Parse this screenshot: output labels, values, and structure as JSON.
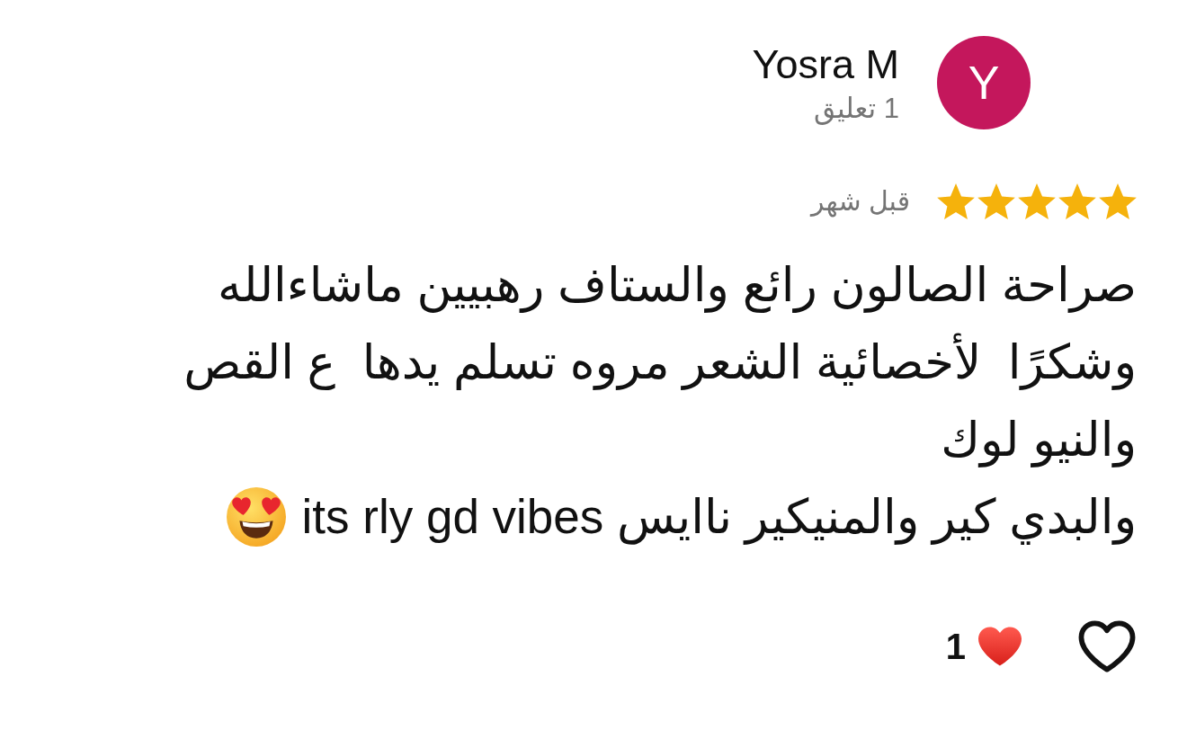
{
  "reviewer": {
    "initial": "Y",
    "name": "Yosra M",
    "comment_count": "1 تعليق"
  },
  "rating": {
    "stars": 5,
    "time": "قبل شهر"
  },
  "review": {
    "paragraphs": [
      "صراحة الصالون رائع والستاف رهبيين ماشاءالله\nوشكرًا  لأخصائية الشعر مروه تسلم يدها  ع القص\nوالنيو لوك",
      "والبدي كير والمنيكير ناايس its rly gd vibes"
    ]
  },
  "reactions": {
    "count": "1",
    "liked": false
  }
}
